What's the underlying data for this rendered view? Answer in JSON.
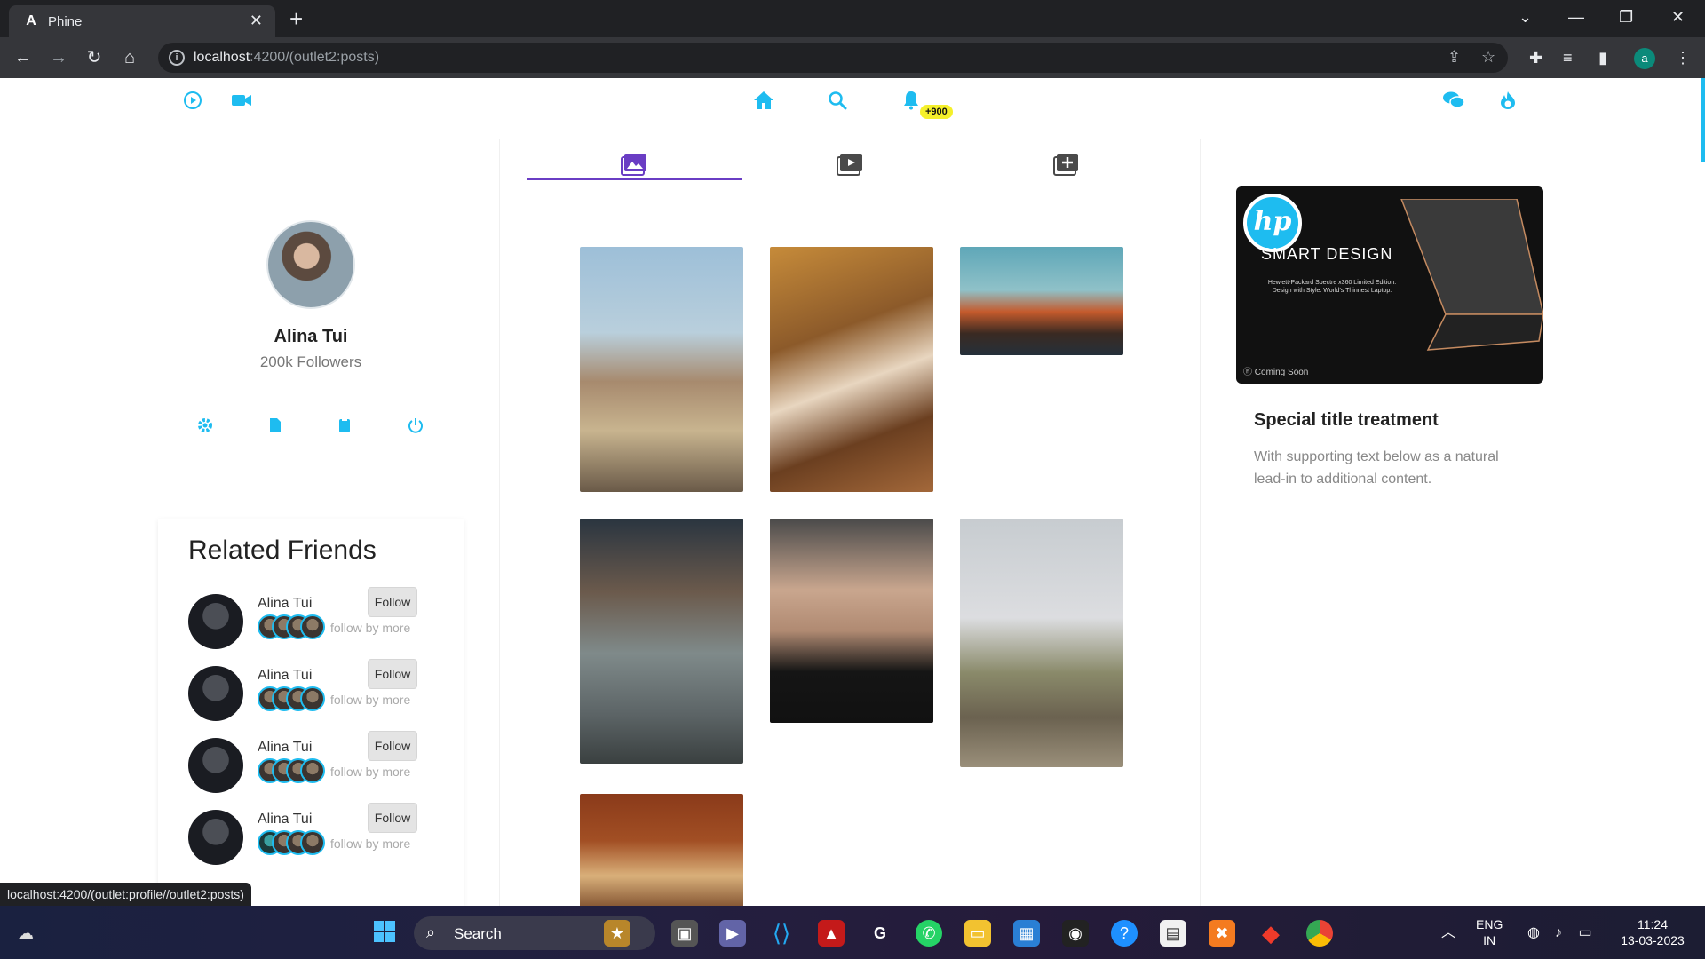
{
  "browser": {
    "tab_title": "Phine",
    "tab_favicon": "A",
    "url_host": "localhost",
    "url_path": ":4200/(outlet2:posts)",
    "profile_initial": "a"
  },
  "app": {
    "topnav": {
      "left_icons": [
        "play-circle-icon",
        "video-camera-icon"
      ],
      "center_icons": [
        "home-icon",
        "search-icon",
        "bell-icon"
      ],
      "notification_badge": "+900",
      "right_icons": [
        "chat-icon",
        "fire-icon"
      ],
      "accent_color": "#1ebcf0"
    },
    "profile": {
      "name": "Alina Tui",
      "followers": "200k Followers",
      "actions": [
        "settings-icon",
        "document-icon",
        "clipboard-icon",
        "power-icon"
      ]
    },
    "related_friends": {
      "title": "Related Friends",
      "friends": [
        {
          "name": "Alina Tui",
          "button": "Follow",
          "subtext": "follow by more"
        },
        {
          "name": "Alina Tui",
          "button": "Follow",
          "subtext": "follow by more"
        },
        {
          "name": "Alina Tui",
          "button": "Follow",
          "subtext": "follow by more"
        },
        {
          "name": "Alina Tui",
          "button": "Follow",
          "subtext": "follow by more"
        }
      ]
    },
    "feed": {
      "tabs": [
        "photos-tab-icon",
        "videos-tab-icon",
        "add-post-tab-icon"
      ],
      "active_tab_color": "#6a3dc4",
      "photos": [
        "bearded-man-on-pier",
        "woman-sitting-on-floor",
        "mountain-sunset",
        "man-grey-tshirt",
        "woman-portrait-dark",
        "woman-on-rock",
        "woman-with-hat"
      ]
    },
    "ad": {
      "brand": "hp",
      "headline": "SMART DESIGN",
      "subline": "Hewlett-Packard Spectre x360 Limited Edition. Design with Style. World's Thinnest Laptop.",
      "footer": "Coming Soon"
    },
    "card": {
      "title": "Special title treatment",
      "text": "With supporting text below as a natural lead-in to additional content."
    }
  },
  "status_url": "localhost:4200/(outlet:profile//outlet2:posts)",
  "taskbar": {
    "search_label": "Search",
    "language_top": "ENG",
    "language_bottom": "IN",
    "time": "11:24",
    "date": "13-03-2023"
  }
}
